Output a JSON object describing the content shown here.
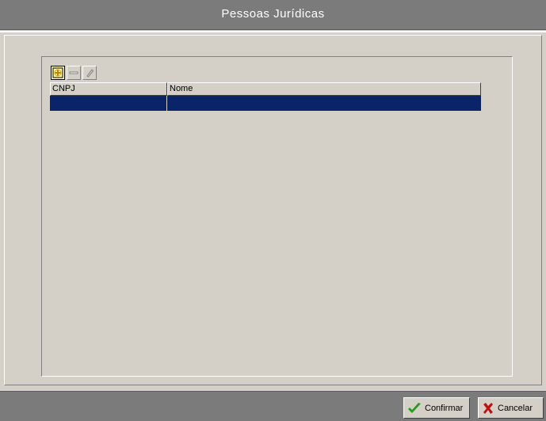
{
  "window": {
    "title": "Pessoas Jurídicas"
  },
  "toolbar": {
    "buttons": [
      {
        "icon": "add-icon"
      },
      {
        "icon": "remove-icon"
      },
      {
        "icon": "edit-icon"
      }
    ]
  },
  "grid": {
    "columns": [
      "CNPJ",
      "Nome"
    ],
    "rows": [
      {
        "cnpj": "",
        "nome": "",
        "selected": true
      }
    ]
  },
  "footer": {
    "confirm_label": "Confirmar",
    "cancel_label": "Cancelar"
  },
  "colors": {
    "titlebar": "#7b7b7b",
    "selection": "#0a246a",
    "confirm_icon": "#2a9a1a",
    "cancel_icon": "#c01010"
  }
}
